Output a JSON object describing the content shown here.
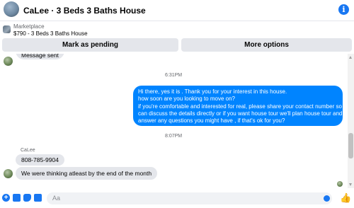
{
  "header": {
    "title": "CaLee · 3 Beds 3 Baths House",
    "info_icon": "i"
  },
  "listing": {
    "label": "Marketplace",
    "title": "$790 - 3 Beds 3 Baths House"
  },
  "actions": {
    "pending_label": "Mark as pending",
    "options_label": "More options"
  },
  "messages": {
    "partial_sent": "Message sent",
    "time1": "6:31PM",
    "outgoing_lines": [
      "Hi there, yes it is . Thank you for your interest in this house.",
      "how soon are you looking to move on?",
      "if you're comfortable and interested for real, please share your contact number so we",
      "can discuss the details directly or if you  want house tour we'll plan house tour and",
      "answer any questions you might have , if that's ok for you?"
    ],
    "time2": "8:07PM",
    "sender_name": "CaLee",
    "incoming_phone": "808-785-9904",
    "incoming_text": "We were thinking atleast by the end of the month"
  },
  "composer": {
    "placeholder": "Aa",
    "plus_glyph": "+",
    "like_glyph": "👍"
  },
  "colors": {
    "accent": "#1877f2",
    "outgoing_bubble": "#0084ff",
    "incoming_bubble": "#e4e6eb"
  }
}
